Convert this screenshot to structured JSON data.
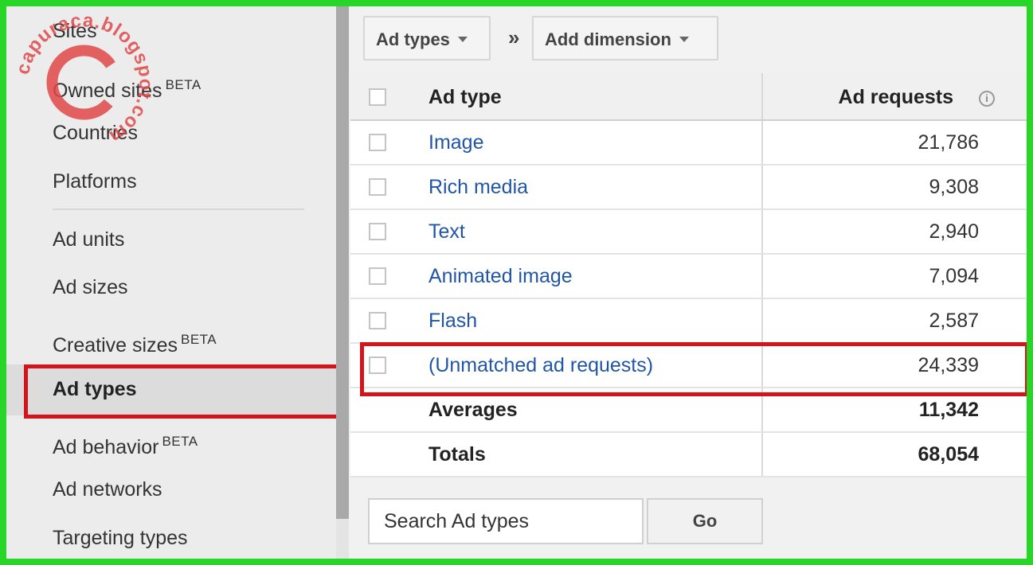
{
  "watermark": {
    "text": "capuraca.blogspot.com",
    "letter": "C"
  },
  "sidebar": {
    "items": [
      {
        "label": "Sites",
        "badge": ""
      },
      {
        "label": "Owned sites",
        "badge": "BETA"
      },
      {
        "label": "Countries",
        "badge": ""
      },
      {
        "label": "Platforms",
        "badge": ""
      },
      {
        "label": "Ad units",
        "badge": ""
      },
      {
        "label": "Ad sizes",
        "badge": ""
      },
      {
        "label": "Creative sizes",
        "badge": "BETA"
      },
      {
        "label": "Ad types",
        "badge": "",
        "selected": true
      },
      {
        "label": "Ad behavior",
        "badge": "BETA"
      },
      {
        "label": "Ad networks",
        "badge": ""
      },
      {
        "label": "Targeting types",
        "badge": ""
      }
    ]
  },
  "toolbar": {
    "dimension_label": "Ad types",
    "separator": "»",
    "add_dimension_label": "Add dimension"
  },
  "table": {
    "headers": {
      "type": "Ad type",
      "requests": "Ad requests",
      "info": "i"
    },
    "rows": [
      {
        "type": "Image",
        "requests": "21,786"
      },
      {
        "type": "Rich media",
        "requests": "9,308"
      },
      {
        "type": "Text",
        "requests": "2,940"
      },
      {
        "type": "Animated image",
        "requests": "7,094"
      },
      {
        "type": "Flash",
        "requests": "2,587"
      },
      {
        "type": "(Unmatched ad requests)",
        "requests": "24,339",
        "highlighted": true
      }
    ],
    "averages": {
      "label": "Averages",
      "requests": "11,342"
    },
    "totals": {
      "label": "Totals",
      "requests": "68,054"
    }
  },
  "search": {
    "value": "Search Ad types",
    "go_label": "Go"
  },
  "colors": {
    "highlight": "#d3141b",
    "link": "#2155a6",
    "frame": "#27d627",
    "watermark": "#e04848"
  }
}
